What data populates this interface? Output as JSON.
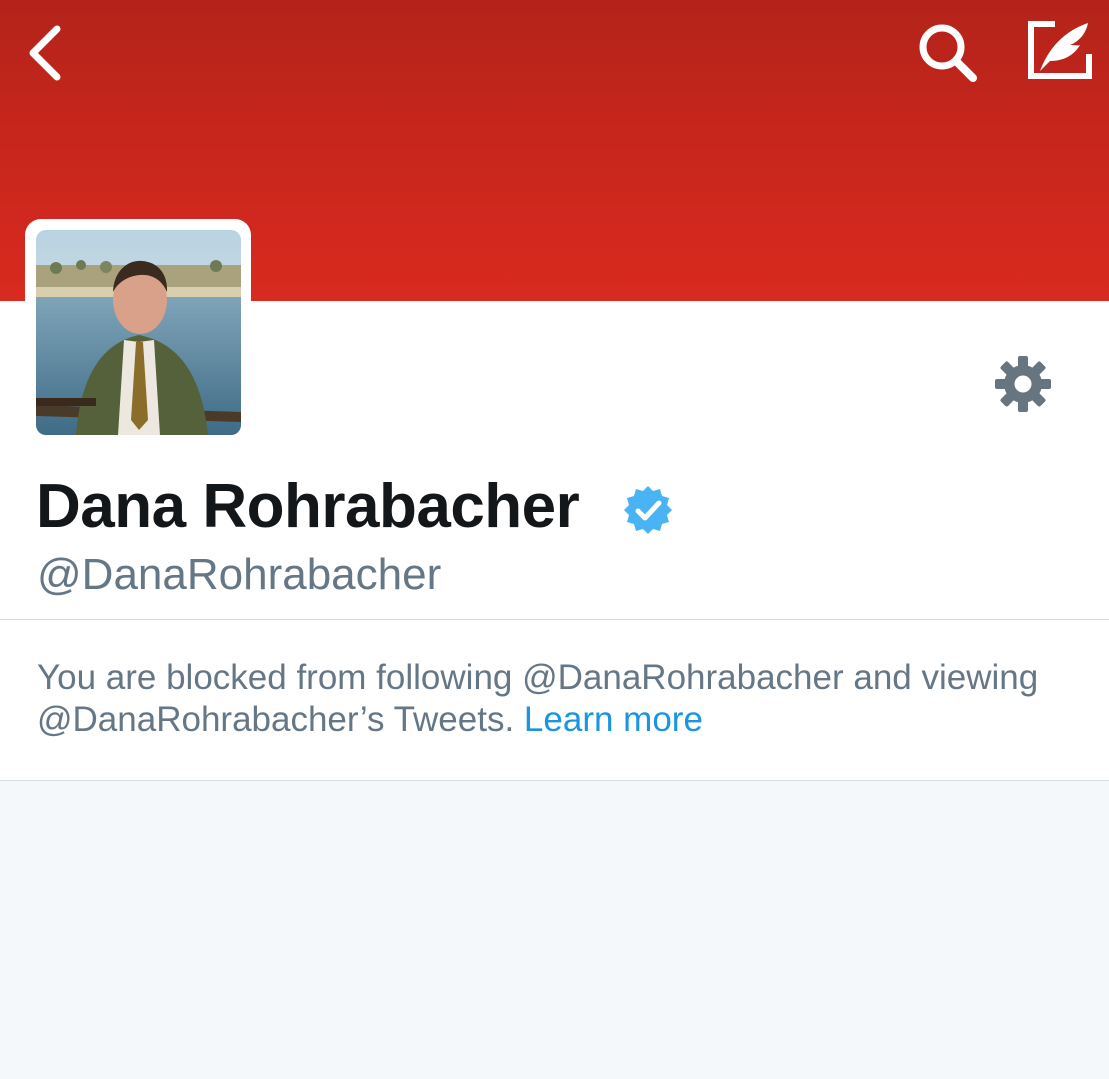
{
  "header": {
    "back_icon": "chevron-left-icon",
    "search_icon": "search-icon",
    "compose_icon": "compose-tweet-icon",
    "banner_color": "#c7261c"
  },
  "profile": {
    "display_name": "Dana Rohrabacher",
    "verified": true,
    "verified_color": "#4ab3f4",
    "handle": "@DanaRohrabacher",
    "settings_icon": "gear-icon"
  },
  "blocked_notice": {
    "message": "You are blocked from following @DanaRohrabacher and viewing @DanaRohrabacher’s Tweets.",
    "link_label": "Learn more",
    "link_color": "#1b95e0"
  }
}
